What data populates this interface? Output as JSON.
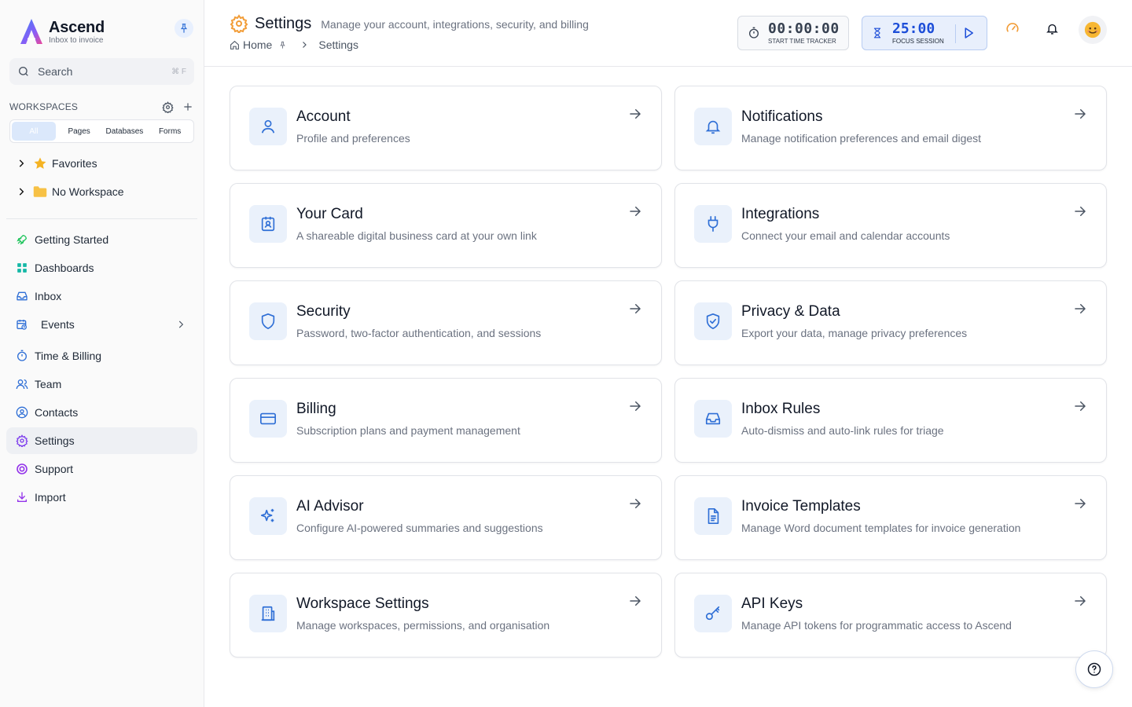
{
  "app": {
    "name": "Ascend",
    "tagline": "Inbox to invoice"
  },
  "search": {
    "label": "Search",
    "shortcut": "⌘ F"
  },
  "workspaces": {
    "title": "WORKSPACES",
    "filters": [
      "All",
      "Pages",
      "Databases",
      "Forms"
    ],
    "active_filter": "All",
    "tree": [
      {
        "label": "Favorites",
        "icon": "star-icon"
      },
      {
        "label": "No Workspace",
        "icon": "folder-icon"
      }
    ]
  },
  "nav": [
    {
      "label": "Getting Started",
      "icon": "rocket-icon"
    },
    {
      "label": "Dashboards",
      "icon": "grid-icon"
    },
    {
      "label": "Inbox",
      "icon": "inbox-icon"
    },
    {
      "label": "Events",
      "icon": "calendar-clock-icon"
    },
    {
      "label": "Time & Billing",
      "icon": "stopwatch-icon"
    },
    {
      "label": "Team",
      "icon": "users-icon"
    },
    {
      "label": "Contacts",
      "icon": "contact-icon"
    },
    {
      "label": "Settings",
      "icon": "gear-icon",
      "active": true
    },
    {
      "label": "Support",
      "icon": "lifebuoy-icon"
    },
    {
      "label": "Import",
      "icon": "download-icon"
    }
  ],
  "header": {
    "title": "Settings",
    "subtitle": "Manage your account, integrations, security, and billing",
    "breadcrumb": {
      "home": "Home",
      "current": "Settings"
    },
    "timer": {
      "value": "00:00:00",
      "caption": "START TIME TRACKER"
    },
    "focus": {
      "value": "25:00",
      "caption": "FOCUS SESSION"
    }
  },
  "cards": [
    {
      "title": "Account",
      "desc": "Profile and preferences",
      "icon": "user-icon"
    },
    {
      "title": "Notifications",
      "desc": "Manage notification preferences and email digest",
      "icon": "bell-icon"
    },
    {
      "title": "Your Card",
      "desc": "A shareable digital business card at your own link",
      "icon": "id-card-icon"
    },
    {
      "title": "Integrations",
      "desc": "Connect your email and calendar accounts",
      "icon": "plug-icon"
    },
    {
      "title": "Security",
      "desc": "Password, two-factor authentication, and sessions",
      "icon": "shield-icon"
    },
    {
      "title": "Privacy & Data",
      "desc": "Export your data, manage privacy preferences",
      "icon": "shield-check-icon"
    },
    {
      "title": "Billing",
      "desc": "Subscription plans and payment management",
      "icon": "credit-card-icon"
    },
    {
      "title": "Inbox Rules",
      "desc": "Auto-dismiss and auto-link rules for triage",
      "icon": "inbox-icon"
    },
    {
      "title": "AI Advisor",
      "desc": "Configure AI-powered summaries and suggestions",
      "icon": "sparkles-icon"
    },
    {
      "title": "Invoice Templates",
      "desc": "Manage Word document templates for invoice generation",
      "icon": "document-icon"
    },
    {
      "title": "Workspace Settings",
      "desc": "Manage workspaces, permissions, and organisation",
      "icon": "building-icon"
    },
    {
      "title": "API Keys",
      "desc": "Manage API tokens for programmatic access to Ascend",
      "icon": "key-icon"
    }
  ],
  "colors": {
    "accent": "#2f6fd6",
    "icon_bg": "#eaf1fb",
    "orange": "#f29d38",
    "purple": "#7c3aed"
  }
}
